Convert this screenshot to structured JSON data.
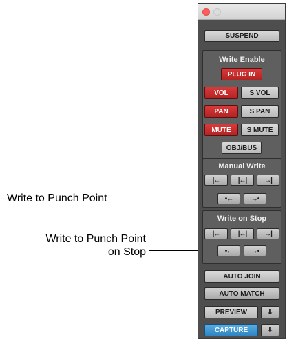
{
  "callouts": {
    "punch_point": "Write to Punch Point",
    "punch_point_stop_line1": "Write to Punch Point",
    "punch_point_stop_line2": "on Stop"
  },
  "window": {
    "suspend_label": "SUSPEND"
  },
  "write_enable": {
    "title": "Write Enable",
    "plugin_label": "PLUG IN",
    "vol_label": "VOL",
    "svol_label": "S VOL",
    "pan_label": "PAN",
    "span_label": "S PAN",
    "mute_label": "MUTE",
    "smute_label": "S MUTE",
    "objbus_label": "OBJ/BUS"
  },
  "manual_write": {
    "title": "Manual Write",
    "icons": {
      "to_start": "|←",
      "to_all": "|↔|",
      "to_end": "→|",
      "to_punch": "•←",
      "to_next": "→•"
    }
  },
  "write_on_stop": {
    "title": "Write on Stop",
    "icons": {
      "to_start": "|←",
      "to_all": "|↔|",
      "to_end": "→|",
      "to_punch": "•←",
      "to_next": "→•"
    }
  },
  "bottom": {
    "auto_join_label": "AUTO JOIN",
    "auto_match_label": "AUTO MATCH",
    "preview_label": "PREVIEW",
    "capture_label": "CAPTURE",
    "down_arrow": "⬇"
  },
  "colors": {
    "enabled_red": "#c92e2e",
    "capture_blue": "#3e98d4",
    "panel_bg": "#4e4e4e"
  }
}
